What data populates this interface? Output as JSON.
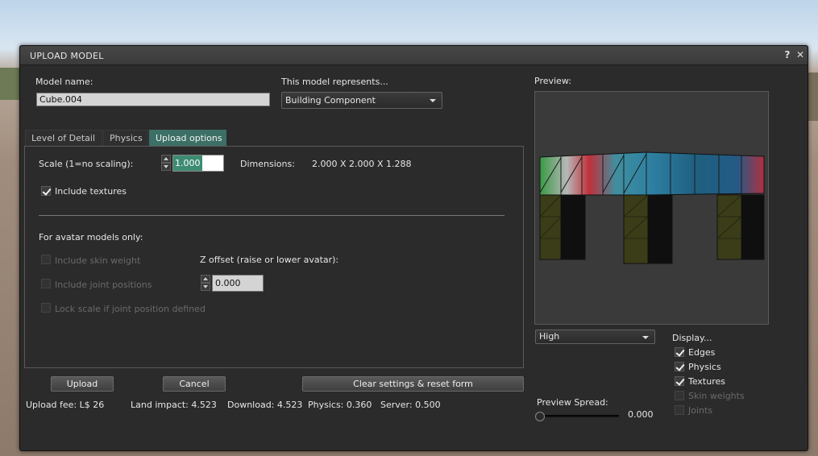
{
  "window": {
    "title": "UPLOAD MODEL",
    "help_label": "?",
    "close_label": "✕"
  },
  "model_name": {
    "label": "Model name:",
    "value": "Cube.004"
  },
  "represents": {
    "label": "This model represents...",
    "selected": "Building Component"
  },
  "tabs": [
    {
      "label": "Level of Detail"
    },
    {
      "label": "Physics"
    },
    {
      "label": "Upload options",
      "active": true
    }
  ],
  "upload_options": {
    "scale_label": "Scale (1=no scaling):",
    "scale_value": "1.000",
    "dimensions_label": "Dimensions:",
    "dimensions_value": "2.000 X 2.000 X 1.288",
    "include_textures_label": "Include textures",
    "include_textures_checked": true,
    "avatar_section_label": "For avatar models only:",
    "include_skin_weight_label": "Include skin weight",
    "include_joint_positions_label": "Include joint positions",
    "lock_scale_label": "Lock scale if joint position defined",
    "z_offset_label": "Z offset (raise or lower avatar):",
    "z_offset_value": "0.000"
  },
  "buttons": {
    "upload": "Upload",
    "cancel": "Cancel",
    "clear": "Clear settings & reset form"
  },
  "stats": {
    "upload_fee": "Upload fee: L$ 26",
    "land_impact": "Land impact: 4.523",
    "download": "Download: 4.523",
    "physics": "Physics: 0.360",
    "server": "Server: 0.500"
  },
  "preview": {
    "label": "Preview:",
    "lod_selected": "High",
    "display_label": "Display...",
    "options": [
      {
        "label": "Edges",
        "checked": true,
        "enabled": true
      },
      {
        "label": "Physics",
        "checked": true,
        "enabled": true
      },
      {
        "label": "Textures",
        "checked": true,
        "enabled": true
      },
      {
        "label": "Skin weights",
        "checked": false,
        "enabled": false
      },
      {
        "label": "Joints",
        "checked": false,
        "enabled": false
      }
    ],
    "spread_label": "Preview Spread:",
    "spread_value": "0.000"
  },
  "colors": {
    "active_tab": "#3c6f66",
    "dialog_bg": "#2b2b2b"
  }
}
